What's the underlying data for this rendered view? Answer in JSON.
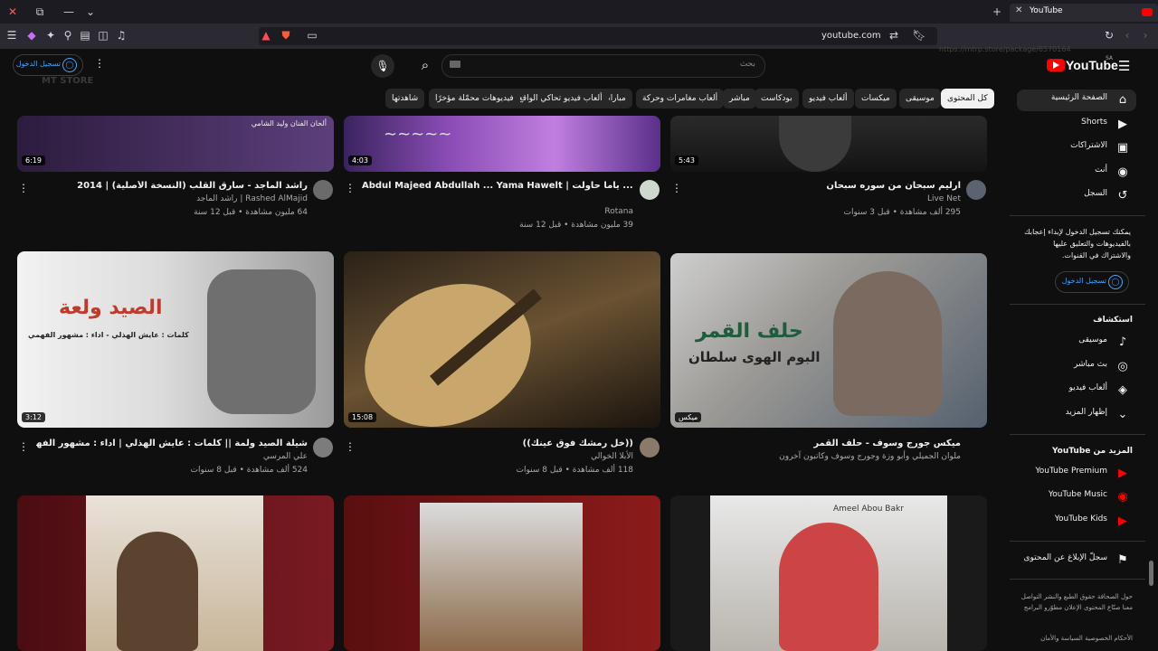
{
  "browser": {
    "tab_title": "YouTube",
    "url": "youtube.com",
    "ghost_tab": "MT Store",
    "ghost_url": "https://mtrp.store/package/6570164"
  },
  "youtube": {
    "logo_text": "YouTube",
    "region": "SA",
    "search_placeholder": "بحث",
    "sign_in": "تسجيل الدخول",
    "chips": [
      "كل المحتوى",
      "موسيقى",
      "ميكسات",
      "ألعاب فيديو",
      "بودكاست",
      "مباشر",
      "ألعاب مغامرات وحركة",
      "مباراة",
      "ألعاب فيديو تحاكي الواقع",
      "فيديوهات محمّلة مؤخرًا",
      "شاهدتها"
    ]
  },
  "sidebar": {
    "main": [
      {
        "label": "الصفحة الرئيسية",
        "icon": "home-icon"
      },
      {
        "label": "Shorts",
        "icon": "shorts-icon"
      },
      {
        "label": "الاشتراكات",
        "icon": "subscriptions-icon"
      },
      {
        "label": "أنت",
        "icon": "you-icon"
      },
      {
        "label": "السجل",
        "icon": "history-icon"
      }
    ],
    "signin_prompt": "يمكنك تسجيل الدخول لإبداء إعجابك بالفيديوهات والتعليق عليها والاشتراك في القنوات.",
    "signin_button": "تسجيل الدخول",
    "explore_title": "استكشاف",
    "explore": [
      {
        "label": "موسيقى",
        "icon": "music-icon"
      },
      {
        "label": "بث مباشر",
        "icon": "live-icon"
      },
      {
        "label": "ألعاب فيديو",
        "icon": "gaming-icon"
      },
      {
        "label": "إظهار المزيد",
        "icon": "chevron-down-icon"
      }
    ],
    "more_title": "المزيد من YouTube",
    "more": [
      {
        "label": "YouTube Premium"
      },
      {
        "label": "YouTube Music"
      },
      {
        "label": "YouTube Kids"
      }
    ],
    "report": "سجلّ الإبلاغ عن المحتوى",
    "footer1": "حول  الصحافة  حقوق الطبع والنشر  التواصل معنا  صنّاع المحتوى  الإعلان  مطوّرو البرامج",
    "footer2": "الأحكام  الخصوصية  السياسة والأمان"
  },
  "videos_row1": [
    {
      "title": "ارليم  سبحان من سوره سبحان",
      "channel": "Live Net",
      "meta": "295 ألف مشاهدة • قبل 3 سنوات",
      "duration": "5:43"
    },
    {
      "title": "Abdul Majeed Abdullah ... Yama Hawelt | عبد المجيد عبد الله ... ياما حاولت",
      "channel": "Rotana",
      "meta": "39 مليون مشاهدة • قبل 12 سنة",
      "duration": "4:03"
    },
    {
      "title": "راشد الماجد - سارق القلب (النسخة الأصلية) | 2014",
      "channel": "Rashed AlMajid | راشد الماجد",
      "meta": "64 مليون مشاهدة • قبل 12 سنة",
      "duration": "6:19",
      "thumb_text": "ألحان الفنان وليد الشامي"
    }
  ],
  "videos_row2": [
    {
      "title": "ميكس جورج وسوف - حلف القمر",
      "channel": "ملوان الجميلي وأبو وزة وجورج وسوف وكاتبون آخرون",
      "meta": "",
      "duration": "ميكس",
      "thumb_text1": "حلف القمر",
      "thumb_text2": "البوم الهوى سلطان"
    },
    {
      "title": "((خل رمشك فوق عينك))",
      "channel": "الأبلا الخوالي",
      "meta": "118 ألف مشاهدة • قبل 8 سنوات",
      "duration": "15:08"
    },
    {
      "title": "شيلة الصيد ولمة || كلمات : عايش الهذلي | اداء : مشهور الفهمي 2018",
      "channel": "علي المرسي",
      "meta": "524 ألف مشاهدة • قبل 8 سنوات",
      "duration": "3:12",
      "thumb_text1": "الصيد ولعة",
      "thumb_text2": "كلمات : عايش الهذلي - اداء : مشهور الفهمي"
    }
  ],
  "row3": {
    "thumb_text": "Ameel Abou Bakr"
  }
}
